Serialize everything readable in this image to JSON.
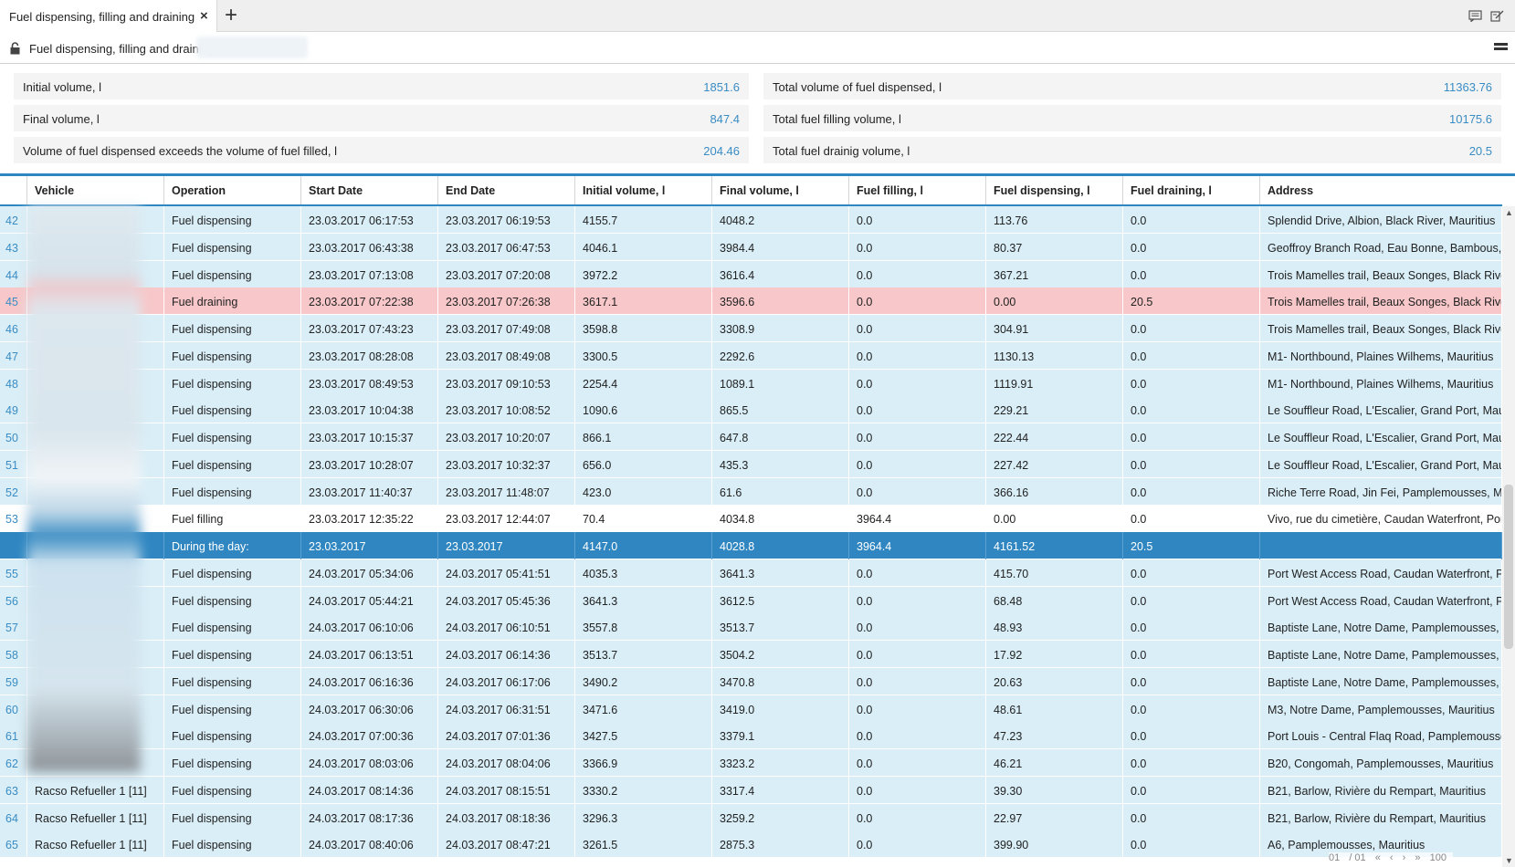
{
  "tabbar": {
    "tab_title": "Fuel dispensing, filling and draining",
    "close_glyph": "×",
    "add_glyph": "+",
    "icons": [
      "chat-icon",
      "edit-note-icon"
    ]
  },
  "header": {
    "title": "Fuel dispensing, filling and draining",
    "lock_icon": "unlock-icon",
    "menu_icon": "hamburger-menu-icon"
  },
  "summary": {
    "left": [
      {
        "label": "Initial volume, l",
        "value": "1851.6"
      },
      {
        "label": "Final volume, l",
        "value": "847.4"
      },
      {
        "label": "Volume of fuel dispensed exceeds the volume of fuel filled, l",
        "value": "204.46"
      }
    ],
    "right": [
      {
        "label": "Total volume of fuel dispensed, l",
        "value": "11363.76"
      },
      {
        "label": "Total fuel filling volume, l",
        "value": "10175.6"
      },
      {
        "label": "Total fuel drainig volume, l",
        "value": "20.5"
      }
    ]
  },
  "table": {
    "columns": [
      "",
      "Vehicle",
      "Operation",
      "Start Date",
      "End Date",
      "Initial volume, l",
      "Final volume, l",
      "Fuel filling, l",
      "Fuel dispensing, l",
      "Fuel draining, l",
      "Address"
    ],
    "rows": [
      {
        "n": "42",
        "vehicle": "",
        "op": "Fuel dispensing",
        "start": "23.03.2017 06:17:53",
        "end": "23.03.2017 06:19:53",
        "init": "4155.7",
        "final": "4048.2",
        "fill": "0.0",
        "disp": "113.76",
        "drain": "0.0",
        "addr": "Splendid Drive, Albion, Black River, Mauritius",
        "type": "normal"
      },
      {
        "n": "43",
        "vehicle": "",
        "op": "Fuel dispensing",
        "start": "23.03.2017 06:43:38",
        "end": "23.03.2017 06:47:53",
        "init": "4046.1",
        "final": "3984.4",
        "fill": "0.0",
        "disp": "80.37",
        "drain": "0.0",
        "addr": "Geoffroy Branch Road, Eau Bonne, Bambous, Blac",
        "type": "normal"
      },
      {
        "n": "44",
        "vehicle": "",
        "op": "Fuel dispensing",
        "start": "23.03.2017 07:13:08",
        "end": "23.03.2017 07:20:08",
        "init": "3972.2",
        "final": "3616.4",
        "fill": "0.0",
        "disp": "367.21",
        "drain": "0.0",
        "addr": "Trois Mamelles trail, Beaux Songes, Black River, M",
        "type": "normal"
      },
      {
        "n": "45",
        "vehicle": "",
        "op": "Fuel draining",
        "start": "23.03.2017 07:22:38",
        "end": "23.03.2017 07:26:38",
        "init": "3617.1",
        "final": "3596.6",
        "fill": "0.0",
        "disp": "0.00",
        "drain": "20.5",
        "addr": "Trois Mamelles trail, Beaux Songes, Black River, M",
        "type": "draining"
      },
      {
        "n": "46",
        "vehicle": "",
        "op": "Fuel dispensing",
        "start": "23.03.2017 07:43:23",
        "end": "23.03.2017 07:49:08",
        "init": "3598.8",
        "final": "3308.9",
        "fill": "0.0",
        "disp": "304.91",
        "drain": "0.0",
        "addr": "Trois Mamelles trail, Beaux Songes, Black River, M",
        "type": "normal"
      },
      {
        "n": "47",
        "vehicle": "",
        "op": "Fuel dispensing",
        "start": "23.03.2017 08:28:08",
        "end": "23.03.2017 08:49:08",
        "init": "3300.5",
        "final": "2292.6",
        "fill": "0.0",
        "disp": "1130.13",
        "drain": "0.0",
        "addr": "M1- Northbound, Plaines Wilhems, Mauritius",
        "type": "normal"
      },
      {
        "n": "48",
        "vehicle": "",
        "op": "Fuel dispensing",
        "start": "23.03.2017 08:49:53",
        "end": "23.03.2017 09:10:53",
        "init": "2254.4",
        "final": "1089.1",
        "fill": "0.0",
        "disp": "1119.91",
        "drain": "0.0",
        "addr": "M1- Northbound, Plaines Wilhems, Mauritius",
        "type": "normal"
      },
      {
        "n": "49",
        "vehicle": "",
        "op": "Fuel dispensing",
        "start": "23.03.2017 10:04:38",
        "end": "23.03.2017 10:08:52",
        "init": "1090.6",
        "final": "865.5",
        "fill": "0.0",
        "disp": "229.21",
        "drain": "0.0",
        "addr": "Le Souffleur Road, L'Escalier, Grand Port, Mauritius",
        "type": "normal"
      },
      {
        "n": "50",
        "vehicle": "",
        "op": "Fuel dispensing",
        "start": "23.03.2017 10:15:37",
        "end": "23.03.2017 10:20:07",
        "init": "866.1",
        "final": "647.8",
        "fill": "0.0",
        "disp": "222.44",
        "drain": "0.0",
        "addr": "Le Souffleur Road, L'Escalier, Grand Port, Mauritius",
        "type": "normal"
      },
      {
        "n": "51",
        "vehicle": "",
        "op": "Fuel dispensing",
        "start": "23.03.2017 10:28:07",
        "end": "23.03.2017 10:32:37",
        "init": "656.0",
        "final": "435.3",
        "fill": "0.0",
        "disp": "227.42",
        "drain": "0.0",
        "addr": "Le Souffleur Road, L'Escalier, Grand Port, Mauritius",
        "type": "normal"
      },
      {
        "n": "52",
        "vehicle": "",
        "op": "Fuel dispensing",
        "start": "23.03.2017 11:40:37",
        "end": "23.03.2017 11:48:07",
        "init": "423.0",
        "final": "61.6",
        "fill": "0.0",
        "disp": "366.16",
        "drain": "0.0",
        "addr": "Riche Terre Road, Jin Fei, Pamplemousses, Maurit",
        "type": "normal"
      },
      {
        "n": "53",
        "vehicle": "",
        "op": "Fuel filling",
        "start": "23.03.2017 12:35:22",
        "end": "23.03.2017 12:44:07",
        "init": "70.4",
        "final": "4034.8",
        "fill": "3964.4",
        "disp": "0.00",
        "drain": "0.0",
        "addr": "Vivo, rue du cimetière, Caudan Waterfront, Port Lo",
        "type": "filling"
      },
      {
        "n": "",
        "vehicle": "",
        "op": "During the day:",
        "start": "23.03.2017",
        "end": "23.03.2017",
        "init": "4147.0",
        "final": "4028.8",
        "fill": "3964.4",
        "disp": "4161.52",
        "drain": "20.5",
        "addr": "",
        "type": "summary-row"
      },
      {
        "n": "55",
        "vehicle": "",
        "op": "Fuel dispensing",
        "start": "24.03.2017 05:34:06",
        "end": "24.03.2017 05:41:51",
        "init": "4035.3",
        "final": "3641.3",
        "fill": "0.0",
        "disp": "415.70",
        "drain": "0.0",
        "addr": "Port West Access Road, Caudan Waterfront, Port I",
        "type": "normal"
      },
      {
        "n": "56",
        "vehicle": "",
        "op": "Fuel dispensing",
        "start": "24.03.2017 05:44:21",
        "end": "24.03.2017 05:45:36",
        "init": "3641.3",
        "final": "3612.5",
        "fill": "0.0",
        "disp": "68.48",
        "drain": "0.0",
        "addr": "Port West Access Road, Caudan Waterfront, Port I",
        "type": "normal"
      },
      {
        "n": "57",
        "vehicle": "",
        "op": "Fuel dispensing",
        "start": "24.03.2017 06:10:06",
        "end": "24.03.2017 06:10:51",
        "init": "3557.8",
        "final": "3513.7",
        "fill": "0.0",
        "disp": "48.93",
        "drain": "0.0",
        "addr": "Baptiste Lane, Notre Dame, Pamplemousses, Mau",
        "type": "normal"
      },
      {
        "n": "58",
        "vehicle": "",
        "op": "Fuel dispensing",
        "start": "24.03.2017 06:13:51",
        "end": "24.03.2017 06:14:36",
        "init": "3513.7",
        "final": "3504.2",
        "fill": "0.0",
        "disp": "17.92",
        "drain": "0.0",
        "addr": "Baptiste Lane, Notre Dame, Pamplemousses, Mau",
        "type": "normal"
      },
      {
        "n": "59",
        "vehicle": "",
        "op": "Fuel dispensing",
        "start": "24.03.2017 06:16:36",
        "end": "24.03.2017 06:17:06",
        "init": "3490.2",
        "final": "3470.8",
        "fill": "0.0",
        "disp": "20.63",
        "drain": "0.0",
        "addr": "Baptiste Lane, Notre Dame, Pamplemousses, Mau",
        "type": "normal"
      },
      {
        "n": "60",
        "vehicle": "",
        "op": "Fuel dispensing",
        "start": "24.03.2017 06:30:06",
        "end": "24.03.2017 06:31:51",
        "init": "3471.6",
        "final": "3419.0",
        "fill": "0.0",
        "disp": "48.61",
        "drain": "0.0",
        "addr": "M3, Notre Dame, Pamplemousses, Mauritius",
        "type": "normal"
      },
      {
        "n": "61",
        "vehicle": "",
        "op": "Fuel dispensing",
        "start": "24.03.2017 07:00:36",
        "end": "24.03.2017 07:01:36",
        "init": "3427.5",
        "final": "3379.1",
        "fill": "0.0",
        "disp": "47.23",
        "drain": "0.0",
        "addr": "Port Louis - Central Flaq Road, Pamplemousses, N",
        "type": "normal"
      },
      {
        "n": "62",
        "vehicle": "",
        "op": "Fuel dispensing",
        "start": "24.03.2017 08:03:06",
        "end": "24.03.2017 08:04:06",
        "init": "3366.9",
        "final": "3323.2",
        "fill": "0.0",
        "disp": "46.21",
        "drain": "0.0",
        "addr": "B20, Congomah, Pamplemousses, Mauritius",
        "type": "normal"
      },
      {
        "n": "63",
        "vehicle": "Racso Refueller 1 [11]",
        "op": "Fuel dispensing",
        "start": "24.03.2017 08:14:36",
        "end": "24.03.2017 08:15:51",
        "init": "3330.2",
        "final": "3317.4",
        "fill": "0.0",
        "disp": "39.30",
        "drain": "0.0",
        "addr": "B21, Barlow, Rivière du Rempart, Mauritius",
        "type": "normal"
      },
      {
        "n": "64",
        "vehicle": "Racso Refueller 1 [11]",
        "op": "Fuel dispensing",
        "start": "24.03.2017 08:17:36",
        "end": "24.03.2017 08:18:36",
        "init": "3296.3",
        "final": "3259.2",
        "fill": "0.0",
        "disp": "22.97",
        "drain": "0.0",
        "addr": "B21, Barlow, Rivière du Rempart, Mauritius",
        "type": "normal"
      },
      {
        "n": "65",
        "vehicle": "Racso Refueller 1 [11]",
        "op": "Fuel dispensing",
        "start": "24.03.2017 08:40:06",
        "end": "24.03.2017 08:47:21",
        "init": "3261.5",
        "final": "2875.3",
        "fill": "0.0",
        "disp": "399.90",
        "drain": "0.0",
        "addr": "A6, Pamplemousses, Mauritius",
        "type": "normal"
      }
    ]
  },
  "pager": {
    "page": "01",
    "total": "/ 01",
    "first": "«",
    "prev": "‹",
    "next": "›",
    "last": "»",
    "page_size": "100"
  }
}
